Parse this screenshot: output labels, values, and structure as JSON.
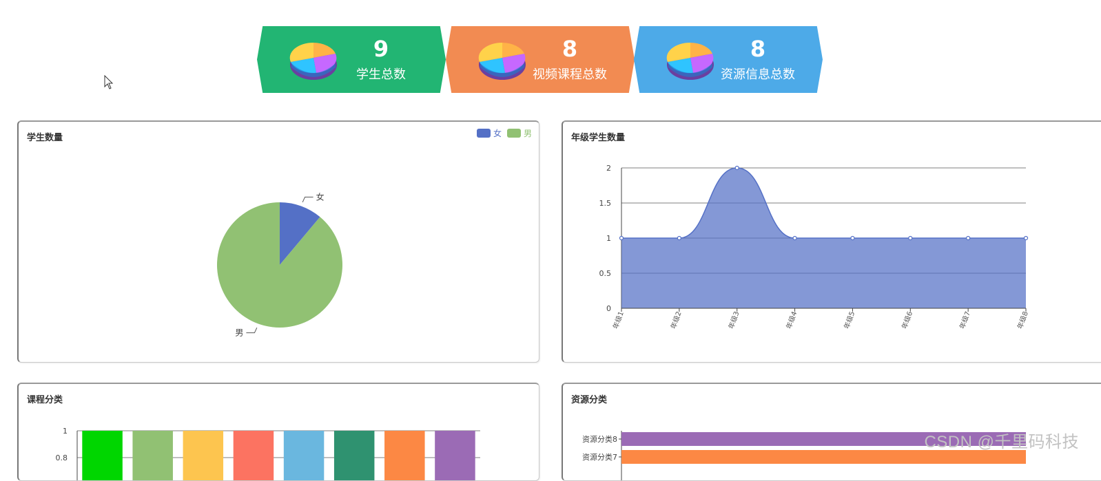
{
  "stats": [
    {
      "value": "9",
      "label": "学生总数",
      "color": "#22b573"
    },
    {
      "value": "8",
      "label": "视频课程总数",
      "color": "#f28b52"
    },
    {
      "value": "8",
      "label": "资源信息总数",
      "color": "#4daae8"
    }
  ],
  "panels": {
    "students": {
      "title": "学生数量"
    },
    "grades": {
      "title": "年级学生数量"
    },
    "courses": {
      "title": "课程分类"
    },
    "resources": {
      "title": "资源分类"
    }
  },
  "watermark": "CSDN @千里码科技",
  "chart_data": [
    {
      "type": "pie",
      "title": "学生数量",
      "categories": [
        "女",
        "男"
      ],
      "values": [
        1,
        8
      ],
      "colors": [
        "#5470c6",
        "#91c173"
      ],
      "legend": "top-right"
    },
    {
      "type": "area",
      "title": "年级学生数量",
      "categories": [
        "年级1",
        "年级2",
        "年级3",
        "年级4",
        "年级5",
        "年级6",
        "年级7",
        "年级8"
      ],
      "values": [
        1,
        1,
        2,
        1,
        1,
        1,
        1,
        1
      ],
      "ylim": [
        0,
        2
      ],
      "yticks": [
        "0",
        "0.5",
        "1",
        "1.5",
        "2"
      ],
      "grid": true,
      "smooth": true,
      "color": "#5470c6"
    },
    {
      "type": "bar",
      "title": "课程分类",
      "yticks_visible": [
        "1",
        "0.8"
      ],
      "values": [
        1,
        1,
        1,
        1,
        1,
        1,
        1,
        1
      ],
      "colors": [
        "#00d600",
        "#91c173",
        "#fdc54f",
        "#fc7361",
        "#6ab7df",
        "#2f9270",
        "#fc8844",
        "#9b6bb5"
      ]
    },
    {
      "type": "bar",
      "orientation": "horizontal",
      "title": "资源分类",
      "categories_visible": [
        "资源分类8",
        "资源分类7"
      ],
      "values": [
        1,
        1
      ],
      "colors": [
        "#9b6bb5",
        "#fc8844"
      ]
    }
  ]
}
